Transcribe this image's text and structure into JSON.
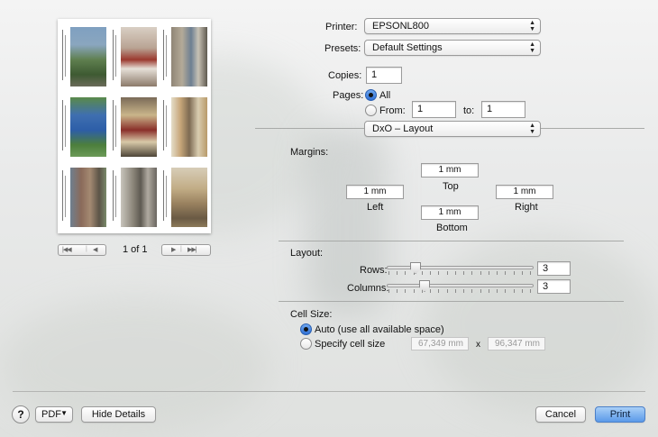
{
  "printer": {
    "label": "Printer:",
    "value": "EPSONL800"
  },
  "presets": {
    "label": "Presets:",
    "value": "Default Settings"
  },
  "copies": {
    "label": "Copies:",
    "value": "1"
  },
  "pages": {
    "label": "Pages:",
    "all_label": "All",
    "from_label": "From:",
    "from_value": "1",
    "to_label": "to:",
    "to_value": "1"
  },
  "panel_popup": {
    "value": "DxO – Layout"
  },
  "margins": {
    "heading": "Margins:",
    "top": {
      "value": "1 mm",
      "label": "Top"
    },
    "left": {
      "value": "1 mm",
      "label": "Left"
    },
    "right": {
      "value": "1 mm",
      "label": "Right"
    },
    "bottom": {
      "value": "1 mm",
      "label": "Bottom"
    }
  },
  "layout": {
    "heading": "Layout:",
    "rows": {
      "label": "Rows:",
      "value": "3",
      "slider_fraction": 0.17
    },
    "columns": {
      "label": "Columns:",
      "value": "3",
      "slider_fraction": 0.24
    }
  },
  "cell_size": {
    "heading": "Cell Size:",
    "auto_label": "Auto (use all available space)",
    "specify_label": "Specify cell size",
    "width": "67,349 mm",
    "times": "x",
    "height": "96,347 mm"
  },
  "preview": {
    "page_indicator": "1 of 1"
  },
  "buttons": {
    "help": "?",
    "pdf": "PDF",
    "hide_details": "Hide Details",
    "cancel": "Cancel",
    "print": "Print"
  },
  "colors": {
    "accent": "#3a78d8",
    "default_button": "#5b9ae9"
  },
  "icons": {
    "pager_first": "first-page-icon",
    "pager_prev": "previous-page-icon",
    "pager_next": "next-page-icon",
    "pager_last": "last-page-icon"
  }
}
